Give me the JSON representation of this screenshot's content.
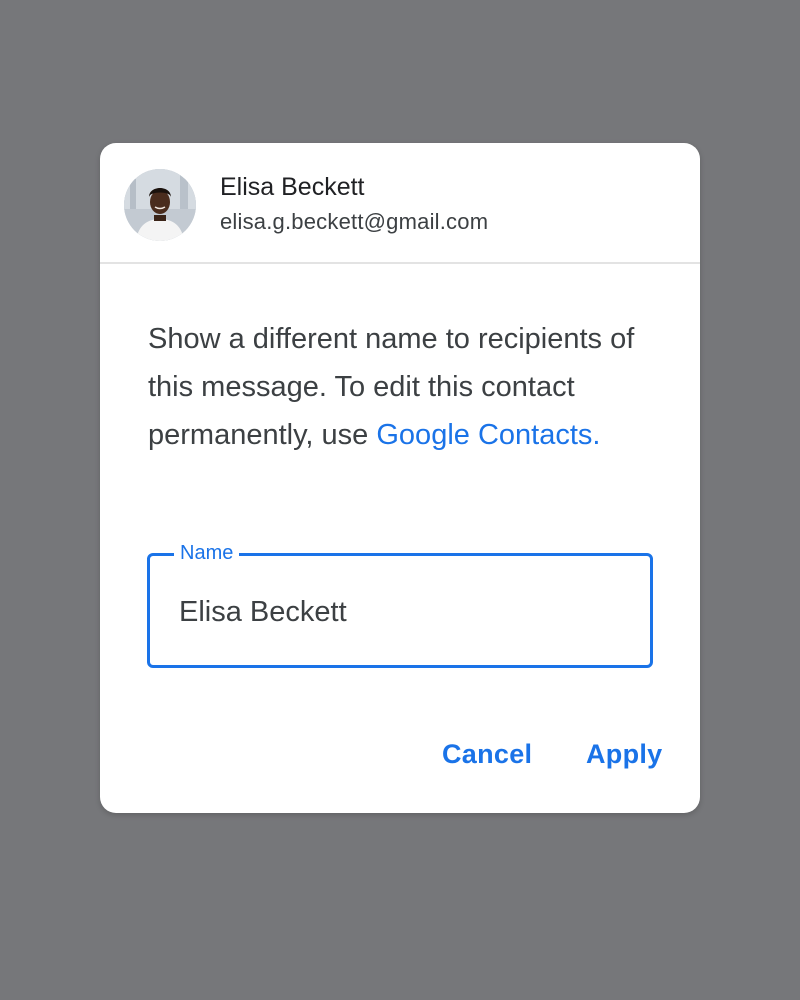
{
  "account": {
    "name": "Elisa Beckett",
    "email": "elisa.g.beckett@gmail.com",
    "avatar": "profile-photo"
  },
  "description": {
    "text": "Show a different name to recipients of this message. To edit this contact permanently, use ",
    "link_text": "Google Contacts."
  },
  "name_field": {
    "label": "Name",
    "value": "Elisa Beckett"
  },
  "actions": {
    "cancel_label": "Cancel",
    "apply_label": "Apply"
  },
  "colors": {
    "accent": "#1a73e8",
    "backdrop": "#76777a",
    "surface": "#ffffff",
    "text": "#3c4043"
  }
}
